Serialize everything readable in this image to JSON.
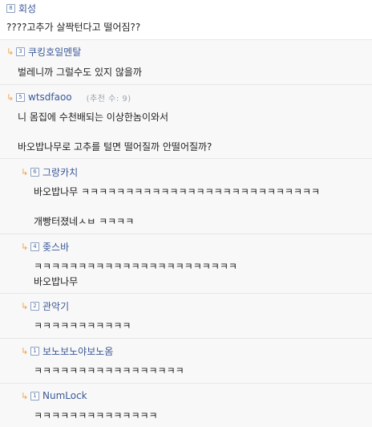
{
  "comments": [
    {
      "arrow": "",
      "level": "8",
      "author": "회성",
      "recommend": "",
      "lines": [
        "????고추가 살짝턴다고 떨어짐??"
      ]
    },
    {
      "arrow": "↳",
      "level": "3",
      "author": "쿠킹호일멘탈",
      "recommend": "",
      "lines": [
        "벌레니까 그럴수도 있지 않을까"
      ]
    },
    {
      "arrow": "↳",
      "level": "5",
      "author": "wtsdfaoo",
      "recommend": "(추천 수: 9)",
      "lines": [
        "니 몸집에 수천배되는 이상한놈이와서",
        "바오밥나무로 고추를 털면 떨어질까 안떨어질까?"
      ]
    },
    {
      "arrow": "↳",
      "level": "6",
      "author": "그랑카치",
      "recommend": "",
      "lines": [
        "바오밥나무 ㅋㅋㅋㅋㅋㅋㅋㅋㅋㅋㅋㅋㅋㅋㅋㅋㅋㅋㅋㅋㅋㅋㅋㅋㅋㅋㅋ",
        "개빵터졌네ㅅㅂ ㅋㅋㅋㅋ"
      ]
    },
    {
      "arrow": "↳",
      "level": "4",
      "author": "좆스바",
      "recommend": "",
      "lines": [
        "ㅋㅋㅋㅋㅋㅋㅋㅋㅋㅋㅋㅋㅋㅋㅋㅋㅋㅋㅋㅋㅋㅋㅋ",
        "바오밥나무"
      ]
    },
    {
      "arrow": "↳",
      "level": "2",
      "author": "관악기",
      "recommend": "",
      "lines": [
        "ㅋㅋㅋㅋㅋㅋㅋㅋㅋㅋㅋ"
      ]
    },
    {
      "arrow": "↳",
      "level": "1",
      "author": "보노보노야보노옴",
      "recommend": "",
      "lines": [
        "ㅋㅋㅋㅋㅋㅋㅋㅋㅋㅋㅋㅋㅋㅋㅋㅋㅋ"
      ]
    },
    {
      "arrow": "↳",
      "level": "1",
      "author": "NumLock",
      "recommend": "",
      "lines": [
        "ㅋㅋㅋㅋㅋㅋㅋㅋㅋㅋㅋㅋㅋㅋ"
      ]
    }
  ]
}
